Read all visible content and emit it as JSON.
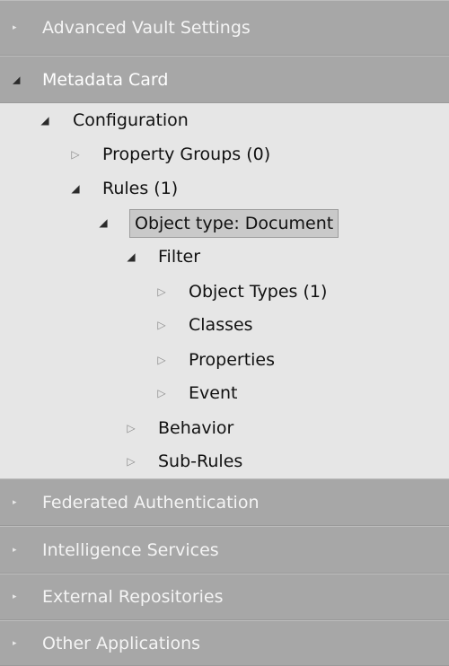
{
  "sections_top": [
    {
      "label": "Advanced Vault Settings",
      "expanded": false
    },
    {
      "label": "Metadata Card",
      "expanded": true
    }
  ],
  "tree": {
    "configuration": "Configuration",
    "property_groups": "Property Groups (0)",
    "rules": "Rules (1)",
    "object_type_document": "Object type: Document",
    "filter": "Filter",
    "object_types": "Object Types (1)",
    "classes": "Classes",
    "properties": "Properties",
    "event": "Event",
    "behavior": "Behavior",
    "sub_rules": "Sub-Rules"
  },
  "sections_bottom": [
    {
      "label": "Federated Authentication",
      "expanded": false
    },
    {
      "label": "Intelligence Services",
      "expanded": false
    },
    {
      "label": "External Repositories",
      "expanded": false
    },
    {
      "label": "Other Applications",
      "expanded": false
    }
  ],
  "icons": {
    "collapsed_section": "right-triangle-small",
    "expanded": "down-right-black-triangle",
    "collapsed_node": "right-hollow-triangle"
  },
  "colors": {
    "section_bg": "#a7a7a7",
    "section_text": "#f4f4f4",
    "tree_bg": "#e6e6e6",
    "selected_bg": "#c9c9c9"
  }
}
